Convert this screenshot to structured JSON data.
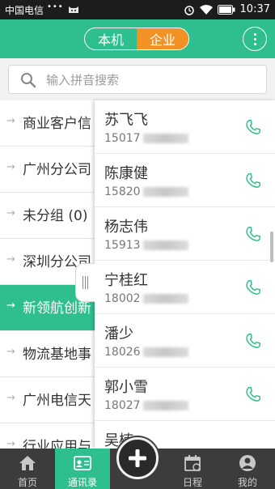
{
  "status_bar": {
    "carrier": "中国电信",
    "dots": "•••",
    "time": "10:37",
    "icons": [
      "cat-icon",
      "alarm-icon",
      "wifi-icon",
      "battery-icon"
    ]
  },
  "header": {
    "segment_left": "本机",
    "segment_right": "企业",
    "active_segment": "企业",
    "accent_color": "#2fbf8f",
    "segment_active_color": "#f39224"
  },
  "search": {
    "placeholder": "输入拼音搜索"
  },
  "groups": [
    {
      "label": "商业客户信"
    },
    {
      "label": "广州分公司"
    },
    {
      "label": "未分组 (0)"
    },
    {
      "label": "深圳分公司"
    },
    {
      "label": "新领航创新"
    },
    {
      "label": "物流基地事"
    },
    {
      "label": "广州电信天"
    },
    {
      "label": "行业应用与"
    }
  ],
  "active_group_index": 4,
  "contacts": [
    {
      "name": "苏飞飞",
      "number_prefix": "15017"
    },
    {
      "name": "陈康健",
      "number_prefix": "15820"
    },
    {
      "name": "杨志伟",
      "number_prefix": "15913"
    },
    {
      "name": "宁桂红",
      "number_prefix": "18002"
    },
    {
      "name": "潘少",
      "number_prefix": "18026"
    },
    {
      "name": "郭小雪",
      "number_prefix": "18027"
    },
    {
      "name": "吴楠",
      "number_prefix": ""
    }
  ],
  "bottom_nav": {
    "tabs": [
      {
        "label": "首页",
        "icon": "home-icon"
      },
      {
        "label": "通讯录",
        "icon": "contacts-icon"
      },
      {
        "label": "日程",
        "icon": "calendar-icon"
      },
      {
        "label": "我的",
        "icon": "profile-icon"
      }
    ],
    "active_tab": "通讯录",
    "center_button_icon": "plus-icon"
  }
}
